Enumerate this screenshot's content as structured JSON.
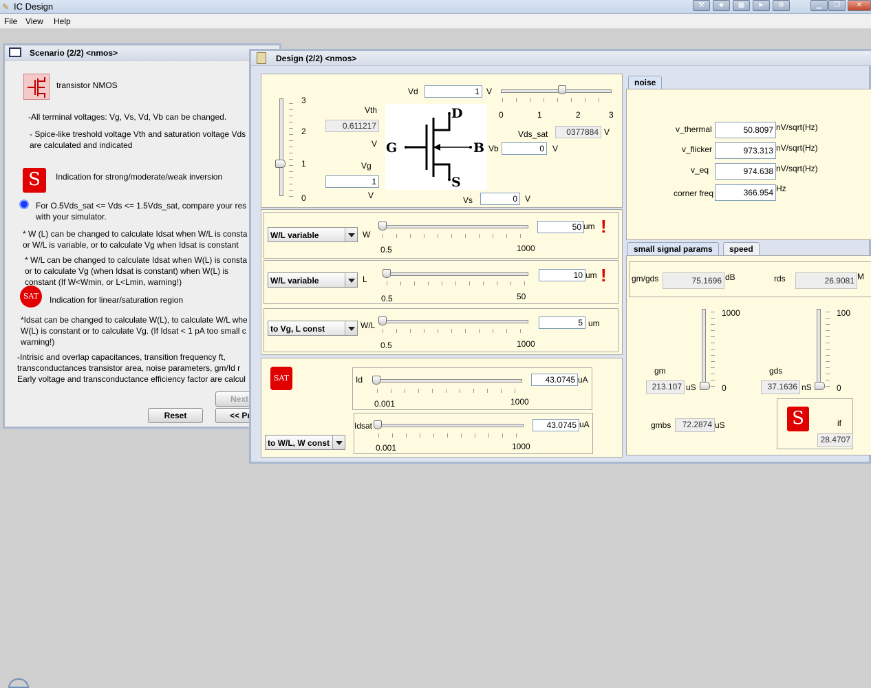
{
  "app": {
    "title": "IC Design"
  },
  "menu": [
    "File",
    "View",
    "Help"
  ],
  "scenario": {
    "title": "Scenario (2/2) <nmos>",
    "transistor_label": "transistor NMOS",
    "lines": [
      "-All terminal voltages: Vg, Vs, Vd, Vb can be changed.",
      "- Spice-like treshold voltage Vth and saturation voltage Vds",
      "are calculated and indicated",
      "Indication for strong/moderate/weak inversion",
      "For O.5Vds_sat <= Vds <= 1.5Vds_sat, compare your res",
      "with your simulator.",
      "* W (L) can be changed to calculate Idsat when W/L is consta",
      "or W/L is variable, or to calculate Vg when Idsat is constant",
      "* W/L can be changed to calculate Idsat when W(L) is consta",
      "or to calculate Vg (when Idsat is constant) when W(L) is",
      "constant (If W<Wmin, or L<Lmin, warning!)",
      "Indication for linear/saturation region",
      "*Idsat can be changed to calculate W(L), to calculate W/L whe",
      "W(L) is constant or to calculate Vg. (If Idsat < 1 pA too small c",
      "warning!)",
      "-Intrisic and overlap capacitances, transition frequency ft,",
      "transconductances transistor area, noise parameters, gm/Id r",
      "Early voltage and transconductance efficiency factor are calcul"
    ],
    "next_label": "Next",
    "reset_label": "Reset",
    "prev_label": "<< Pr"
  },
  "design": {
    "title": "Design (2/2) <nmos>",
    "vd_label": "Vd",
    "vd_value": "1",
    "vd_unit": "V",
    "vd_slider_ticks": [
      "0",
      "1",
      "2",
      "3"
    ],
    "vd_slider_level": 0.55,
    "vg_slider_ticks": [
      "3",
      "2",
      "1",
      "0"
    ],
    "vg_slider_level": 0.33,
    "vth_label": "Vth",
    "vth_value": "0.611217",
    "vth_unit": "V",
    "vg_label": "Vg",
    "vg_value": "1",
    "vg_unit": "V",
    "vds_sat_label": "Vds_sat",
    "vds_sat_value": "0377884",
    "vds_sat_unit": "V",
    "vb_label": "Vb",
    "vb_value": "0",
    "vb_unit": "V",
    "vs_label": "Vs",
    "vs_value": "0",
    "vs_unit": "V",
    "terminals": {
      "d": "D",
      "g": "G",
      "b": "B",
      "s": "S"
    },
    "w_row": {
      "mode": "W/L variable",
      "label": "W",
      "value": "50",
      "unit": "um",
      "min": "0.5",
      "max": "1000",
      "warn": "!"
    },
    "l_row": {
      "mode": "W/L variable",
      "label": "L",
      "value": "10",
      "unit": "um",
      "min": "0.5",
      "max": "50",
      "warn": "!"
    },
    "wl_row": {
      "mode": "to Vg, L const",
      "label": "W/L",
      "value": "5",
      "unit": "um",
      "min": "0.5",
      "max": "1000"
    },
    "sat_icon": "SAT",
    "id_row": {
      "label": "Id",
      "value": "43.0745",
      "unit": "uA",
      "min": "0.001",
      "max": "1000"
    },
    "idsat_row": {
      "label": "Idsat",
      "value": "43.0745",
      "unit": "uA",
      "min": "0.001",
      "max": "1000"
    },
    "bottom_mode": "to W/L, W const"
  },
  "noise": {
    "tab": "noise",
    "rows": [
      {
        "label": "v_thermal",
        "value": "50.8097",
        "unit": "nV/sqrt(Hz)"
      },
      {
        "label": "v_flicker",
        "value": "973.313",
        "unit": "nV/sqrt(Hz)"
      },
      {
        "label": "v_eq",
        "value": "974.638",
        "unit": "nV/sqrt(Hz)"
      },
      {
        "label": "corner freq",
        "value": "366.954",
        "unit": "Hz"
      }
    ]
  },
  "ssp": {
    "tabs": [
      "small signal params",
      "speed"
    ],
    "gm_gds_label": "gm/gds",
    "gm_gds_value": "75.1696",
    "gm_gds_unit": "dB",
    "rds_label": "rds",
    "rds_value": "26.9081",
    "rds_unit": "M",
    "gm_label": "gm",
    "gm_value": "213.107",
    "gm_unit": "uS",
    "gm_max": "1000",
    "gm_min": "0",
    "gds_label": "gds",
    "gds_value": "37.1636",
    "gds_unit": "nS",
    "gds_max": "100",
    "gds_min": "0",
    "gmbs_label": "gmbs",
    "gmbs_value": "72.2874",
    "gmbs_unit": "uS",
    "if_label": "if",
    "if_value": "28.4707"
  }
}
